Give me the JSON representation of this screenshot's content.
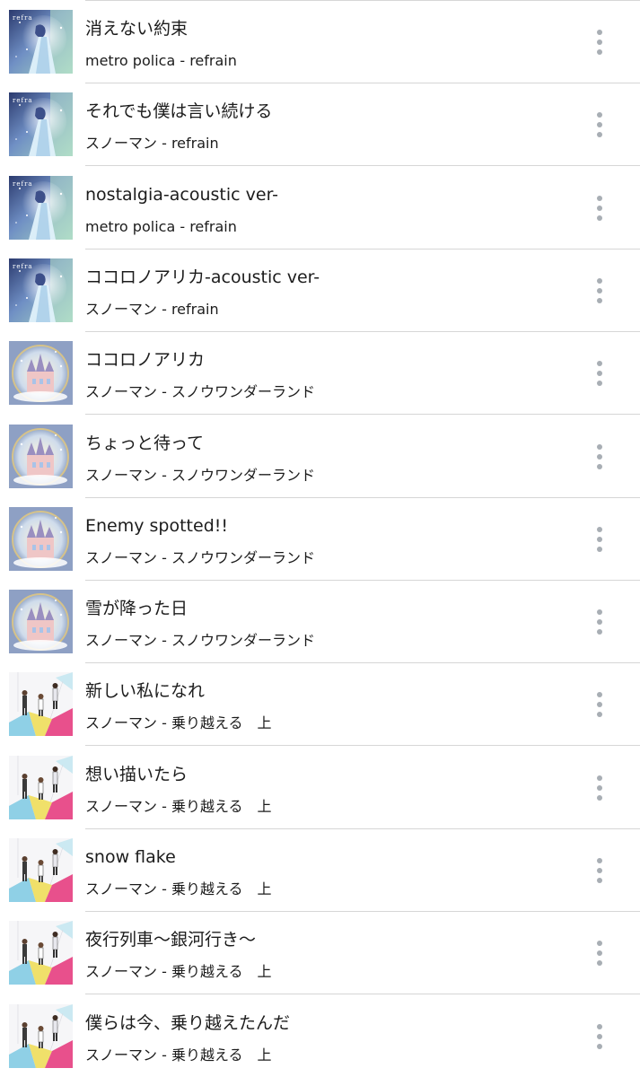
{
  "tracks": [
    {
      "title": "消えない約束",
      "subtitle": "metro polica - refrain",
      "art": "refrain"
    },
    {
      "title": "それでも僕は言い続ける",
      "subtitle": "スノーマン - refrain",
      "art": "refrain"
    },
    {
      "title": "nostalgia-acoustic ver-",
      "subtitle": "metro polica - refrain",
      "art": "refrain"
    },
    {
      "title": "ココロノアリカ-acoustic ver-",
      "subtitle": "スノーマン - refrain",
      "art": "refrain"
    },
    {
      "title": "ココロノアリカ",
      "subtitle": "スノーマン - スノウワンダーランド",
      "art": "wonderland"
    },
    {
      "title": "ちょっと待って",
      "subtitle": "スノーマン - スノウワンダーランド",
      "art": "wonderland"
    },
    {
      "title": "Enemy spotted!!",
      "subtitle": "スノーマン - スノウワンダーランド",
      "art": "wonderland"
    },
    {
      "title": "雪が降った日",
      "subtitle": "スノーマン - スノウワンダーランド",
      "art": "wonderland"
    },
    {
      "title": "新しい私になれ",
      "subtitle": "スノーマン - 乗り越える　上",
      "art": "norikoeru"
    },
    {
      "title": "想い描いたら",
      "subtitle": "スノーマン - 乗り越える　上",
      "art": "norikoeru"
    },
    {
      "title": "snow flake",
      "subtitle": "スノーマン - 乗り越える　上",
      "art": "norikoeru"
    },
    {
      "title": "夜行列車〜銀河行き〜",
      "subtitle": "スノーマン - 乗り越える　上",
      "art": "norikoeru"
    },
    {
      "title": "僕らは今、乗り越えたんだ",
      "subtitle": "スノーマン - 乗り越える　上",
      "art": "norikoeru"
    }
  ],
  "menu_icon": "more-vertical-icon",
  "colors": {
    "text": "#1c1c1c",
    "divider": "#d6d6d6",
    "menu_dots": "#a8aeb4"
  }
}
